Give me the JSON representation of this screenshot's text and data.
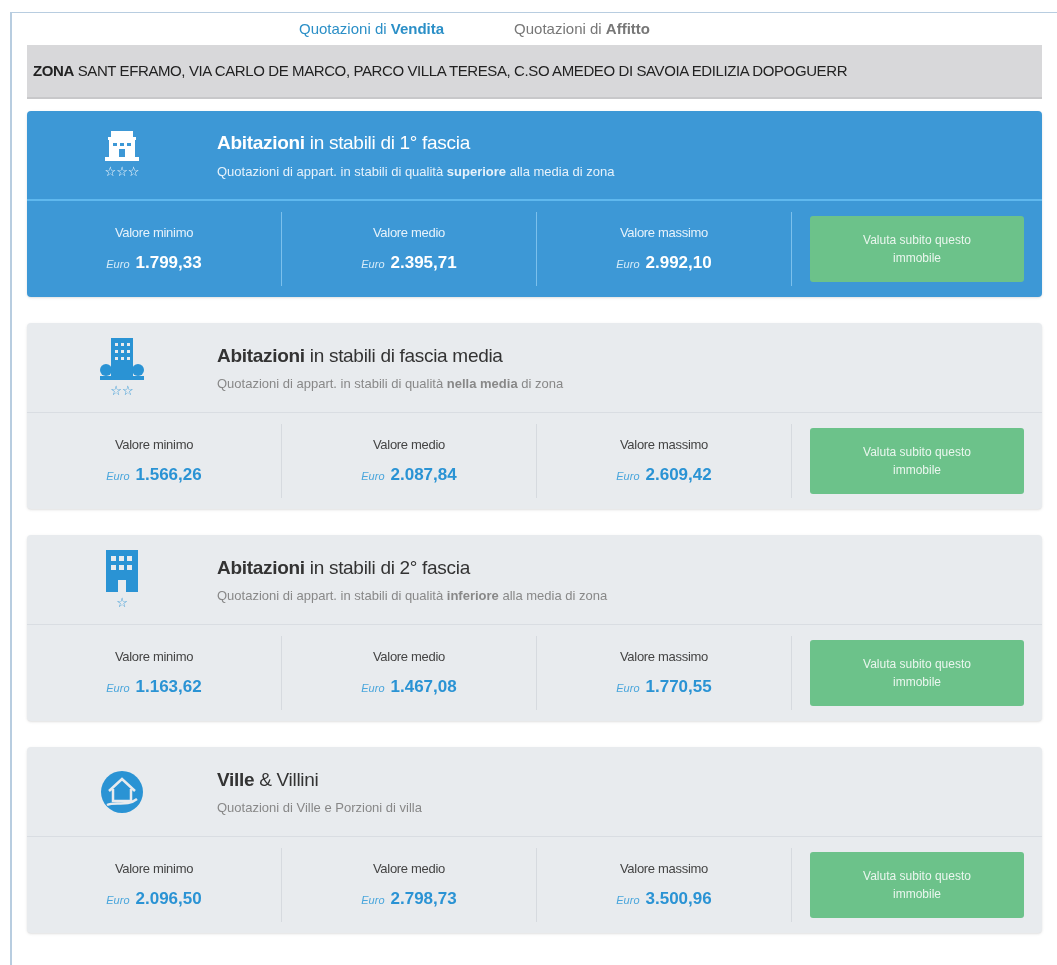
{
  "tabs": [
    {
      "label": "Quotazioni di **Vendita**",
      "selected": true
    },
    {
      "label": "Quotazioni di **Affitto**",
      "selected": false
    }
  ],
  "zona": "**ZONA** SANT EFRAMO, VIA CARLO DE MARCO, PARCO VILLA TERESA, C.SO AMEDEO DI SAVOIA EDILIZIA DOPOGUERR",
  "cards": [
    {
      "kind": "classic",
      "selected": true,
      "rating": "☆☆☆",
      "title": "**Abitazioni** in stabili di 1° fascia",
      "subtitle": "Quotazioni di appart. in stabili di qualità **superiore** alla media di zona",
      "values": [
        {
          "label": "Valore minimo",
          "currency": "Euro",
          "amount": "1.799,33"
        },
        {
          "label": "Valore medio",
          "currency": "Euro",
          "amount": "2.395,71"
        },
        {
          "label": "Valore massimo",
          "currency": "Euro",
          "amount": "2.992,10"
        }
      ],
      "button": "Valuta subito questo immobile"
    },
    {
      "kind": "tower",
      "selected": false,
      "rating": "☆☆",
      "title": "**Abitazioni** in stabili di fascia media",
      "subtitle": "Quotazioni di appart. in stabili di qualità **nella media** di zona",
      "values": [
        {
          "label": "Valore minimo",
          "currency": "Euro",
          "amount": "1.566,26"
        },
        {
          "label": "Valore medio",
          "currency": "Euro",
          "amount": "2.087,84"
        },
        {
          "label": "Valore massimo",
          "currency": "Euro",
          "amount": "2.609,42"
        }
      ],
      "button": "Valuta subito questo immobile"
    },
    {
      "kind": "office",
      "selected": false,
      "rating": "☆",
      "title": "**Abitazioni** in stabili di 2° fascia",
      "subtitle": "Quotazioni di appart. in stabili di qualità **inferiore** alla media di zona",
      "values": [
        {
          "label": "Valore minimo",
          "currency": "Euro",
          "amount": "1.163,62"
        },
        {
          "label": "Valore medio",
          "currency": "Euro",
          "amount": "1.467,08"
        },
        {
          "label": "Valore massimo",
          "currency": "Euro",
          "amount": "1.770,55"
        }
      ],
      "button": "Valuta subito questo immobile"
    },
    {
      "kind": "villa",
      "selected": false,
      "title": "**Ville** & Villini",
      "subtitle": "Quotazioni di Ville e Porzioni di villa",
      "values": [
        {
          "label": "Valore minimo",
          "currency": "Euro",
          "amount": "2.096,50"
        },
        {
          "label": "Valore medio",
          "currency": "Euro",
          "amount": "2.798,73"
        },
        {
          "label": "Valore massimo",
          "currency": "Euro",
          "amount": "3.500,96"
        }
      ],
      "button": "Valuta subito questo immobile"
    }
  ]
}
